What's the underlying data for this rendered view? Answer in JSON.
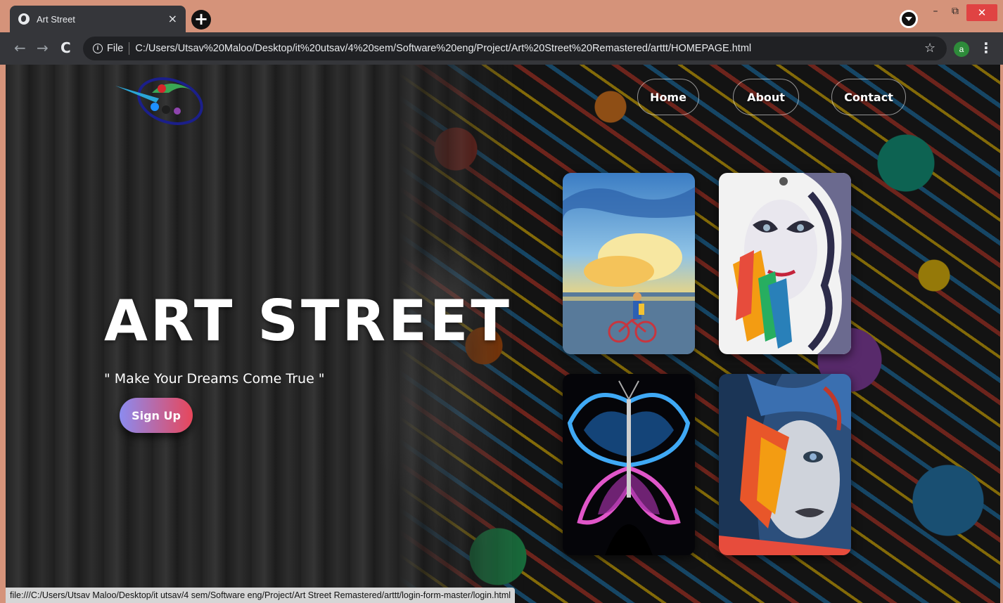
{
  "browser": {
    "tab": {
      "title": "Art Street",
      "close": "×"
    },
    "new_tab": "+",
    "window_controls": {
      "minimize": "–",
      "maximize": "⧉",
      "close": "✕"
    },
    "nav": {
      "back": "←",
      "forward": "→",
      "reload": "C"
    },
    "address": {
      "info": "i",
      "scheme_label": "File",
      "url": "C:/Users/Utsav%20Maloo/Desktop/it%20utsav/4%20sem/Software%20eng/Project/Art%20Street%20Remastered/arttt/HOMEPAGE.html"
    },
    "bookmark": "☆",
    "profile_initial": "a",
    "menu": "⋮"
  },
  "page": {
    "nav": {
      "home": "Home",
      "about": "About",
      "contact": "Contact"
    },
    "hero": {
      "title": "ART STREET",
      "tagline": "\" Make Your Dreams Come True \"",
      "signup_label": "Sign Up"
    },
    "gallery": [
      {
        "icon": "boy-with-bicycle-painting"
      },
      {
        "icon": "face-with-paint-splash-painting"
      },
      {
        "icon": "neon-butterfly-art"
      },
      {
        "icon": "graffiti-woman-portrait"
      }
    ]
  },
  "status_bar": {
    "link": "file:///C:/Users/Utsav Maloo/Desktop/it utsav/4 sem/Software eng/Project/Art Street Remastered/arttt/login-form-master/login.html"
  }
}
